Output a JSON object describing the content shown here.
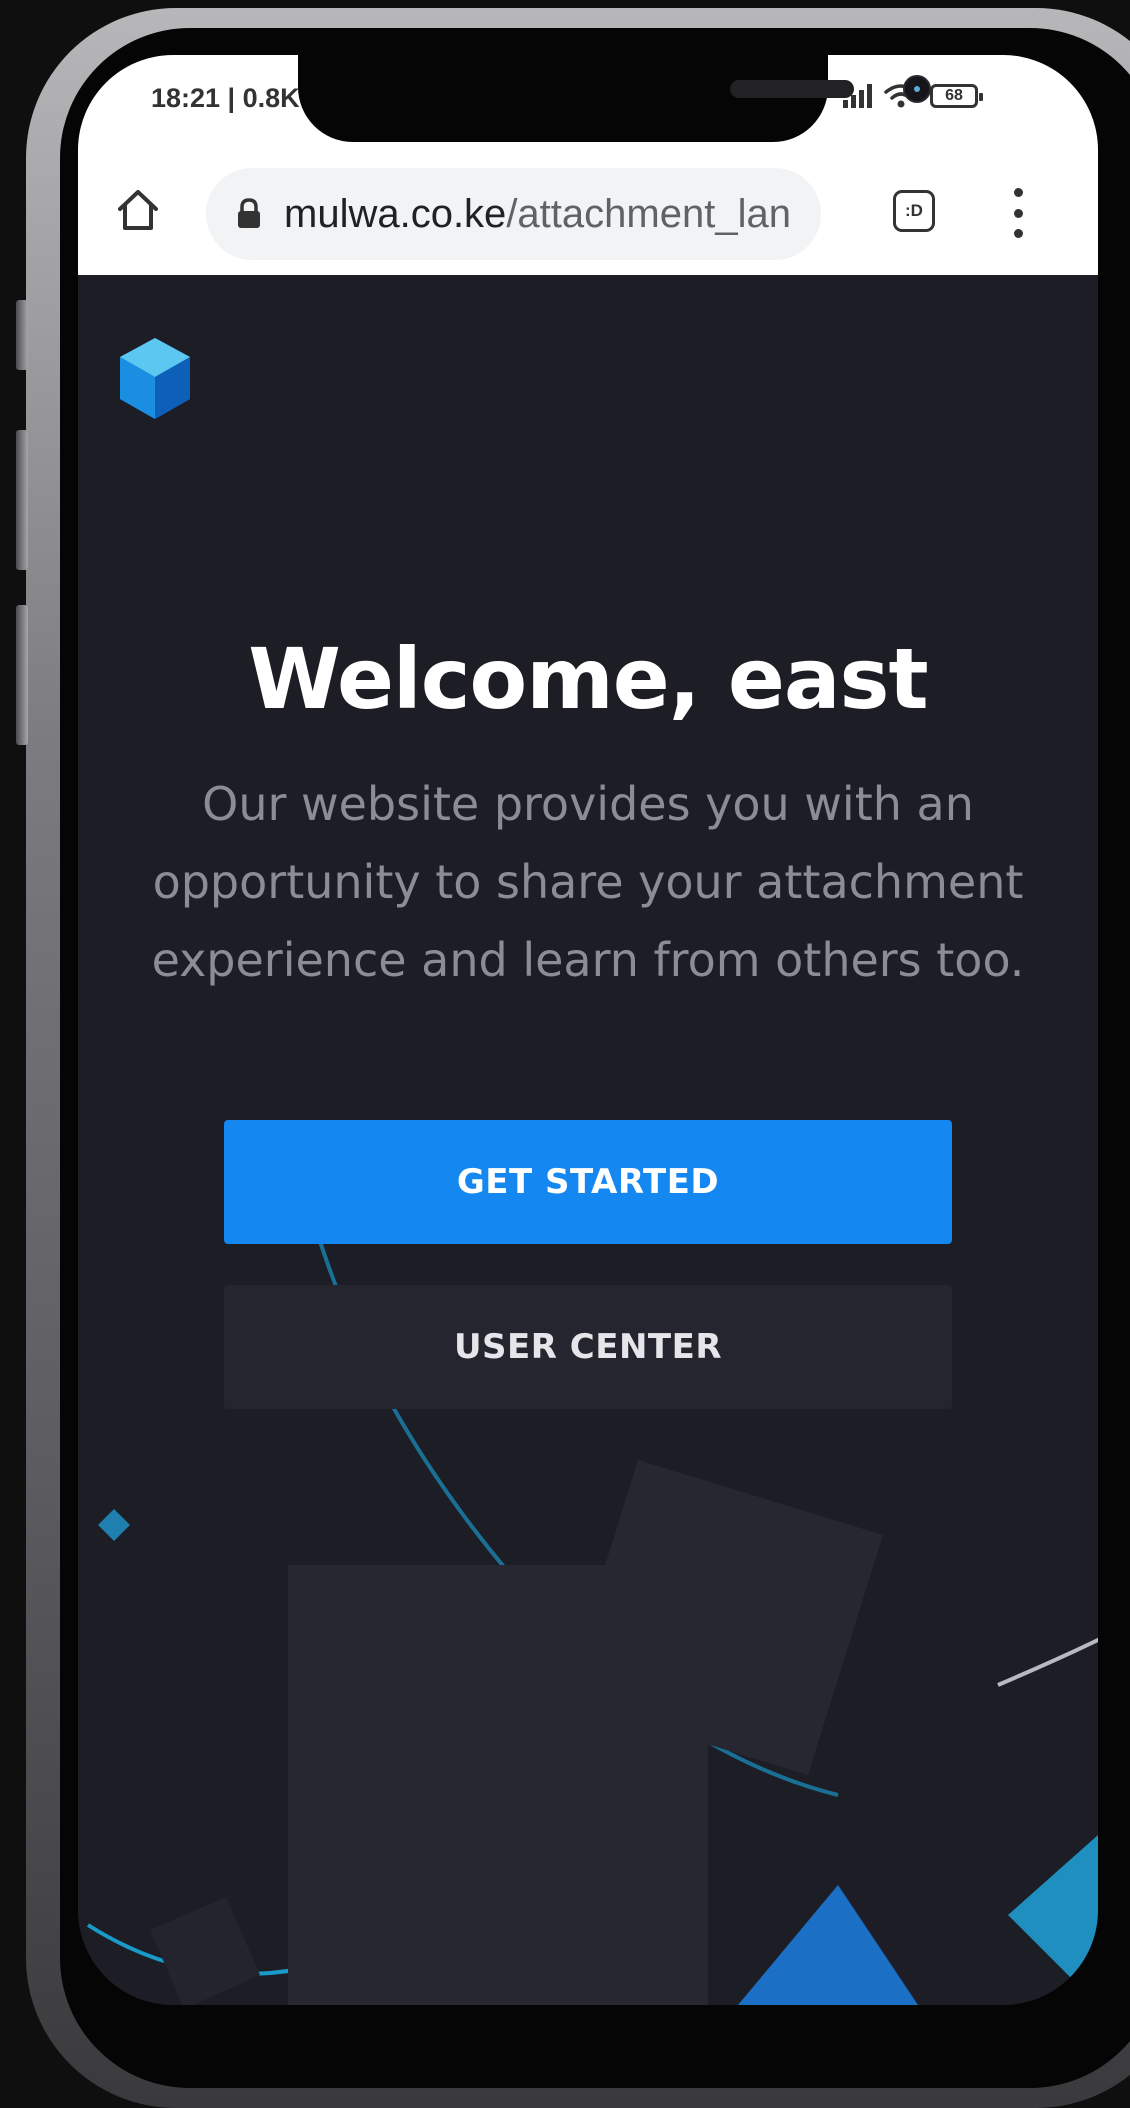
{
  "status_bar": {
    "time": "18:21 | 0.8K",
    "battery": "68"
  },
  "browser": {
    "url_domain": "mulwa.co.ke",
    "url_path": "/attachment_lan",
    "tab_switcher_label": ":D"
  },
  "hero": {
    "title": "Welcome, east",
    "description": "Our website provides you with an opportunity to share your attachment experience and learn from others too."
  },
  "actions": {
    "primary_label": "GET STARTED",
    "secondary_label": "USER CENTER"
  },
  "colors": {
    "page_background": "#1c1d25",
    "primary_button": "#1487f0",
    "secondary_button": "#24252e",
    "logo_accent": "#2aa3e0"
  },
  "icons": [
    "home-icon",
    "lock-icon",
    "tab-switcher-icon",
    "more-vert-icon",
    "signal-icon",
    "wifi-icon",
    "battery-icon",
    "cube-logo-icon"
  ]
}
